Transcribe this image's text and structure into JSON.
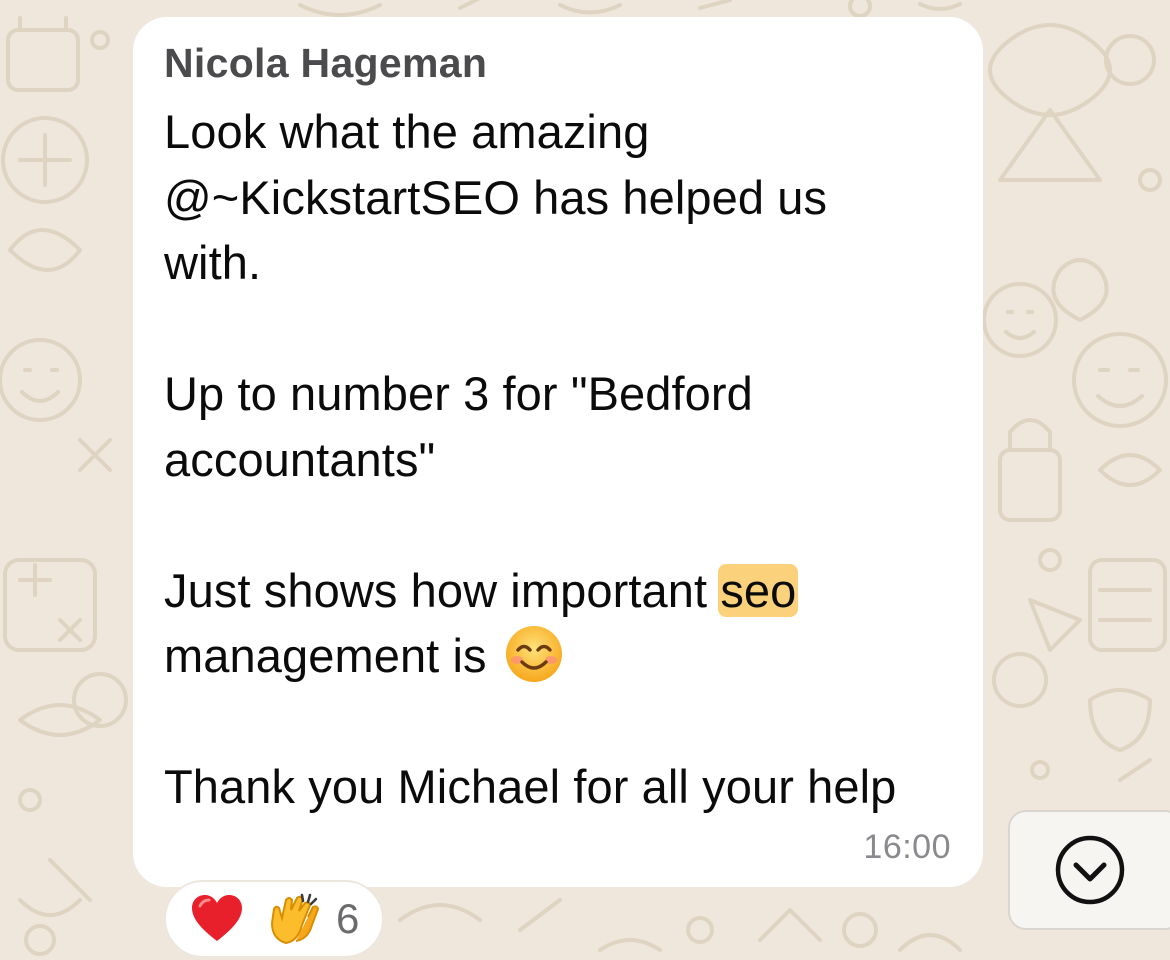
{
  "message": {
    "sender": "Nicola Hageman",
    "line1": "Look what the amazing",
    "line2": "@~KickstartSEO has helped us",
    "line3": "with.",
    "line4": "Up to number 3 for \"Bedford",
    "line5": "accountants\"",
    "line6_before": "Just shows how important",
    "line6_highlight": "seo",
    "line7": "management is",
    "line8": "Thank you Michael for all your help",
    "time": "16:00",
    "highlight_color": "#fbd27b"
  },
  "reactions": {
    "icons": [
      "red-heart-icon",
      "clapping-hands-icon"
    ],
    "count": "6"
  },
  "scroll_button": {
    "icon": "chevron-down-circle-icon"
  },
  "colors": {
    "wallpaper": "#efe7dc",
    "bubble": "#ffffff"
  }
}
